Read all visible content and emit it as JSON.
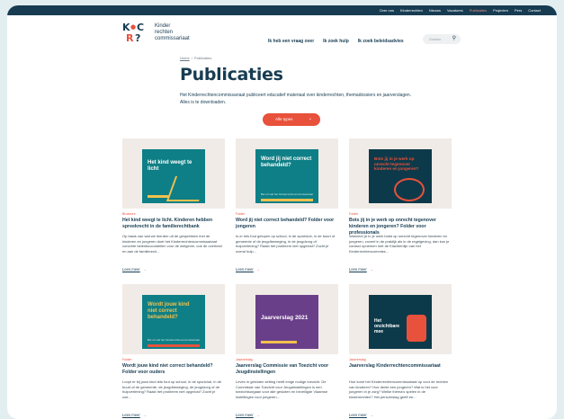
{
  "top_nav": [
    "Over ons",
    "Kinderrechten",
    "Nieuws",
    "Vacatures",
    "Publicaties",
    "Projecten",
    "Pers",
    "Contact"
  ],
  "top_nav_active": "Publicaties",
  "logo": {
    "letters": [
      "K",
      "C",
      "R",
      "?"
    ],
    "line1": "Kinder",
    "line2": "rechten",
    "line3": "commissariaat"
  },
  "main_nav": [
    "Ik heb een vraag over",
    "Ik zoek hulp",
    "Ik zoek beleidsadvies"
  ],
  "search": {
    "placeholder": "Zoeken",
    "icon": "search-icon"
  },
  "breadcrumb": {
    "home": "Home",
    "sep": "›",
    "current": "Publicaties"
  },
  "page_title": "Publicaties",
  "intro": "Het Kinderrechtencommissariaat publiceert educatief materiaal over kinderrechten, themadossiers en jaarverslagen. Alles is te downloaden.",
  "filter": {
    "label": "Alle types",
    "icon": "chevron-down-icon"
  },
  "read_more": "Lees meer",
  "colors": {
    "accent": "#e8513b",
    "navy": "#173c52",
    "teal": "#0e7f86",
    "dark_teal": "#0d3a4a",
    "orange": "#e8513b"
  },
  "cards": [
    {
      "category": "Brochure",
      "title": "Het kind weegt te licht. Kinderen hebben spreekrecht in de familierechtbank",
      "desc": "Op basis van wat we leerden uit de gesprekken met de kinderen en jongeren doet het Kinderrechtencommissariaat concrete beleidsvoorstellen voor de wetgever, ook de overheid en aan de familierech...",
      "cover_title": "Het kind weegt te licht",
      "cover_sub": "",
      "cover_logo": ""
    },
    {
      "category": "Folder",
      "title": "Word jij niet correct behandeld? Folder voor jongeren",
      "desc": "Is er iets fout gelopen op school, in de sportclub, in de buurt of gemeente of de jeugdbeweging, in de jeugdzorg of hulpverlening? Raakt het probleem niet opgelost? Zocht je overal hulp...",
      "cover_title": "Word jij niet correct behandeld?",
      "cover_sub": "Bel of mail het Kinderrechtencommissariaat",
      "cover_logo": ""
    },
    {
      "category": "Folder",
      "title": "Bots jij in je werk op onrecht tegenover kinderen en jongeren? Folder voor professionals",
      "desc": "Wanneer je in je werk botst op onrecht tegenover kinderen en jongeren, zoveel in de praktijk als in de regelgeving, dan kun je contact opnemen met de Klachtenlijn van het Kinderrechtencommiss...",
      "cover_title": "Bots jij in je werk op onrecht tegenover kinderen en jongeren?",
      "cover_sub": "",
      "cover_logo": ""
    },
    {
      "category": "Folder",
      "title": "Wordt jouw kind niet correct behandeld? Folder voor ouders",
      "desc": "Loopt er bij jouw kind iets fout op school, in de sportclub, in de buurt of de gemeente, de jeugdbeweging, de jeugdzorg of de hulpverlening? Raakt het probleem niet opgelost? Zocht je zoe...",
      "cover_title": "Wordt jouw kind niet correct behandeld?",
      "cover_sub": "Bel of mail het Kinderrechtencommissariaat",
      "cover_logo": ""
    },
    {
      "category": "Jaarverslag",
      "title": "Jaarverslag Commissie van Toezicht voor Jeugdinstellingen",
      "desc": "Leven in gesloten setting heeft enige nodige toezicht. De Commissie van Toezicht voor Jeugdinstellingen is een toezichtsorgaan voor alle gesloten en beveiligde Vlaamse instellingen voor jongeren...",
      "cover_title": "Jaarverslag 2021",
      "cover_sub": "",
      "cover_logo": ""
    },
    {
      "category": "Jaarverslag",
      "title": "Jaarverslag Kinderrechtencommissariaat",
      "desc": "Hoe komt het Kinderrechtencommissariaat op voor de rechten van kinderen? Hoe denkt een jongeren? Wat is het voor jongeren in je zorg? Welke thema's spelen in de kinderrechten? Het persverslag geeft ee...",
      "cover_title": "Het onzichtbare mee",
      "cover_sub": "",
      "cover_logo": ""
    }
  ]
}
